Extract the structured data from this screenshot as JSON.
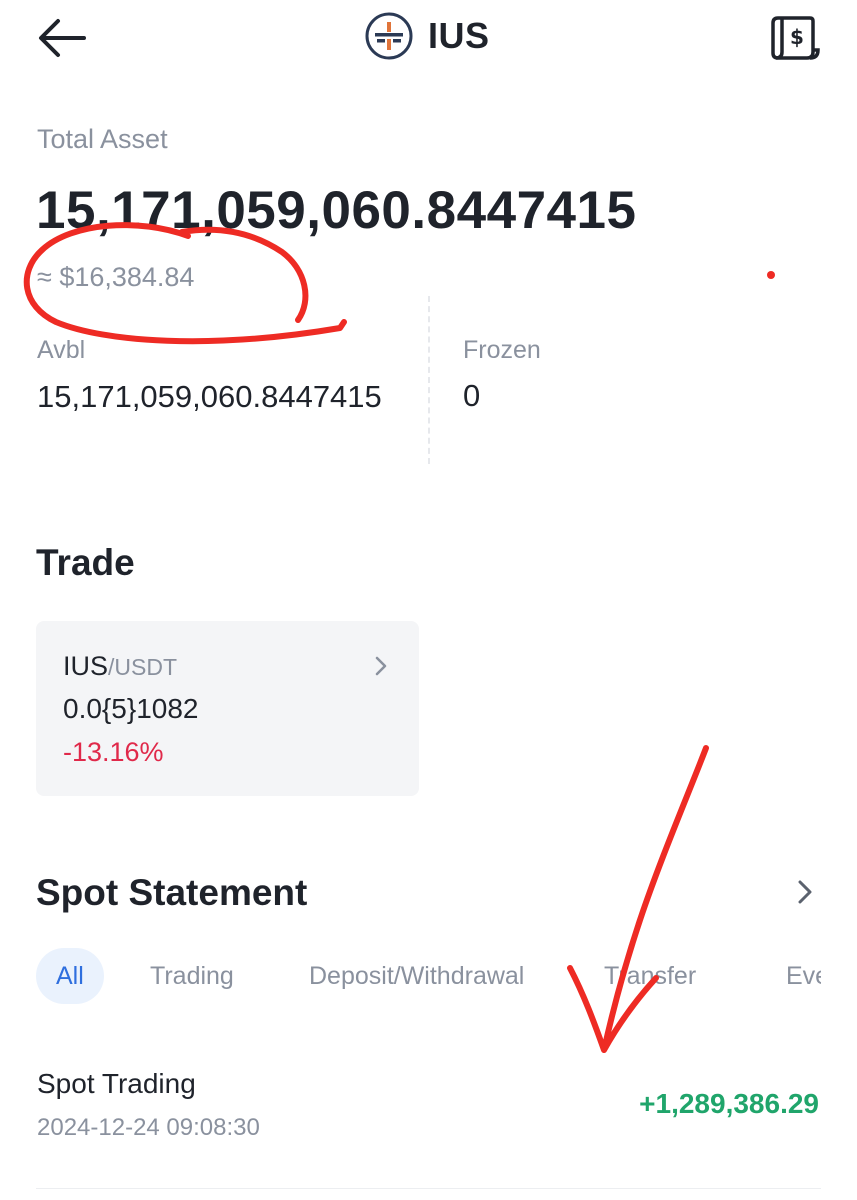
{
  "header": {
    "back_icon": "arrow-left-icon",
    "brand_name": "IUS",
    "logo_icon": "ius-logo-icon",
    "bill_icon": "dollar-receipt-icon"
  },
  "asset": {
    "total_label": "Total Asset",
    "total_value": "15,171,059,060.8447415",
    "approx_value": "≈ $16,384.84",
    "avbl_label": "Avbl",
    "avbl_value": "15,171,059,060.8447415",
    "frozen_label": "Frozen",
    "frozen_value": "0"
  },
  "trade": {
    "title": "Trade",
    "card": {
      "base": "IUS",
      "quote": "/USDT",
      "price": "0.0{5}1082",
      "change": "-13.16%"
    }
  },
  "spot": {
    "title": "Spot Statement",
    "tabs": [
      {
        "label": "All"
      },
      {
        "label": "Trading"
      },
      {
        "label": "Deposit/Withdrawal"
      },
      {
        "label": "Transfer"
      },
      {
        "label": "Eve"
      }
    ],
    "rows": [
      {
        "title": "Spot Trading",
        "time": "2024-12-24 09:08:30",
        "amount": "+1,289,386.29"
      }
    ]
  },
  "colors": {
    "negative": "#e0294a",
    "positive": "#20a56b",
    "accent": "#2f6fde",
    "annotation": "#ee2b24"
  }
}
